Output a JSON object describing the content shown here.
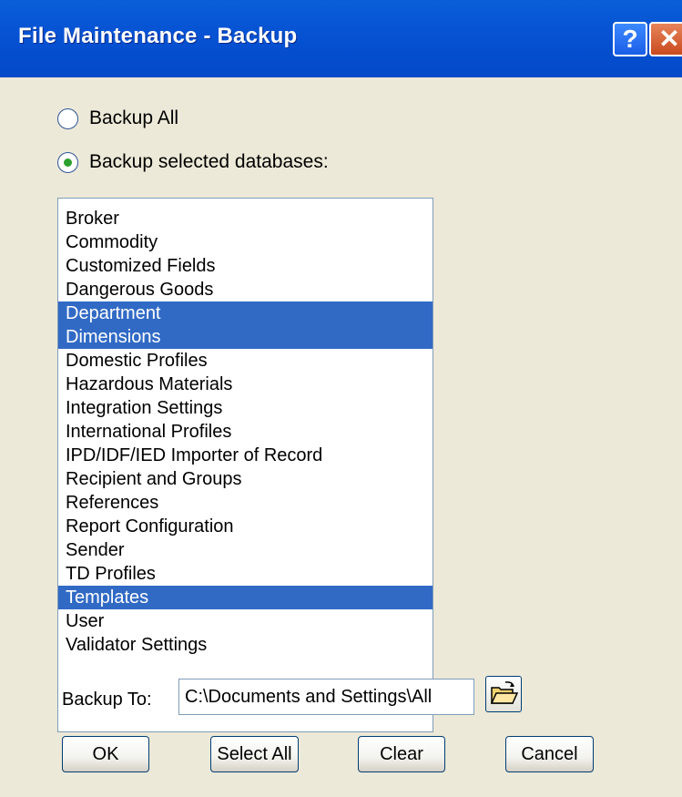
{
  "window": {
    "title": "File Maintenance - Backup",
    "help_label": "?",
    "close_label": "✕"
  },
  "options": {
    "backup_all_label": "Backup All",
    "backup_selected_label": "Backup selected databases:",
    "selected": "backup_selected"
  },
  "databases": {
    "items": [
      {
        "label": "Broker",
        "selected": false
      },
      {
        "label": "Commodity",
        "selected": false
      },
      {
        "label": "Customized Fields",
        "selected": false
      },
      {
        "label": "Dangerous Goods",
        "selected": false
      },
      {
        "label": "Department",
        "selected": true
      },
      {
        "label": "Dimensions",
        "selected": true
      },
      {
        "label": "Domestic Profiles",
        "selected": false
      },
      {
        "label": "Hazardous Materials",
        "selected": false
      },
      {
        "label": "Integration Settings",
        "selected": false
      },
      {
        "label": "International Profiles",
        "selected": false
      },
      {
        "label": "IPD/IDF/IED Importer of Record",
        "selected": false
      },
      {
        "label": "Recipient and Groups",
        "selected": false
      },
      {
        "label": "References",
        "selected": false
      },
      {
        "label": "Report Configuration",
        "selected": false
      },
      {
        "label": "Sender",
        "selected": false
      },
      {
        "label": "TD Profiles",
        "selected": false
      },
      {
        "label": "Templates",
        "selected": true
      },
      {
        "label": "User",
        "selected": false
      },
      {
        "label": "Validator Settings",
        "selected": false
      }
    ]
  },
  "backup_to": {
    "label": "Backup To:",
    "value": "C:\\Documents and Settings\\All"
  },
  "buttons": {
    "ok": "OK",
    "select_all": "Select All",
    "clear": "Clear",
    "cancel": "Cancel"
  },
  "colors": {
    "title_bar": "#0653d4",
    "selection": "#316ac5",
    "dialog_bg": "#ece9d8"
  }
}
